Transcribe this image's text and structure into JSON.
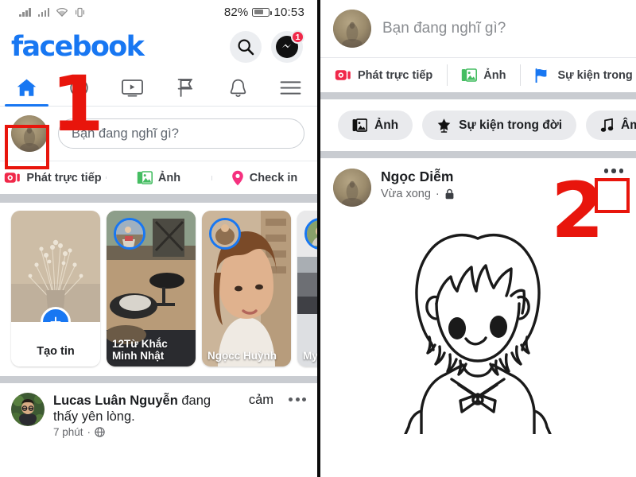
{
  "left_panel": {
    "status_bar": {
      "battery_percent": "82%",
      "time": "10:53",
      "icons": [
        "signal-icon",
        "signal-icon",
        "wifi-icon",
        "vibrate-icon",
        "battery-icon"
      ]
    },
    "header": {
      "wordmark": "facebook",
      "search_icon": "search-icon",
      "messenger_icon": "messenger-icon",
      "messenger_badge": "1"
    },
    "tabs": [
      {
        "name": "home",
        "icon": "home-icon",
        "active": true
      },
      {
        "name": "friends",
        "icon": "friends-icon",
        "active": false
      },
      {
        "name": "watch",
        "icon": "video-icon",
        "active": false
      },
      {
        "name": "marketplace",
        "icon": "flag-icon",
        "active": false
      },
      {
        "name": "notifications",
        "icon": "bell-icon",
        "active": false
      },
      {
        "name": "menu",
        "icon": "hamburger-icon",
        "active": false
      }
    ],
    "composer": {
      "placeholder": "Bạn đang nghĩ gì?",
      "avatar": "user-avatar"
    },
    "actions": [
      {
        "label": "Phát trực tiếp",
        "icon": "live-video-icon",
        "color": "#f02849"
      },
      {
        "label": "Ảnh",
        "icon": "photo-icon",
        "color": "#45bd62"
      },
      {
        "label": "Check in",
        "icon": "location-pin-icon",
        "color": "#f5317f"
      }
    ],
    "stories": [
      {
        "label": "Tạo tin",
        "type": "create",
        "icon": "plus-icon"
      },
      {
        "label": "12Từ Khắc Minh Nhật",
        "type": "story"
      },
      {
        "label": "Ngọcc Huỳnh",
        "type": "story"
      },
      {
        "label": "My",
        "type": "story"
      }
    ],
    "feed_post": {
      "author": "Lucas Luân Nguyễn",
      "action_word": "đang",
      "feeling_word": "cảm",
      "feeling_line2": "thấy yên lòng.",
      "time": "7 phút",
      "privacy_icon": "globe-icon",
      "more_icon": "more-options-icon"
    }
  },
  "right_panel": {
    "composer": {
      "placeholder": "Bạn đang nghĩ gì?",
      "avatar": "user-avatar"
    },
    "actions": [
      {
        "label": "Phát trực tiếp",
        "icon": "live-video-icon",
        "color": "#f02849"
      },
      {
        "label": "Ảnh",
        "icon": "photo-icon",
        "color": "#45bd62"
      },
      {
        "label": "Sự kiện trong đời",
        "icon": "flag-icon",
        "color": "#1877f2"
      }
    ],
    "chips": [
      {
        "label": "Ảnh",
        "icon": "photo-icon"
      },
      {
        "label": "Sự kiện trong đời",
        "icon": "star-icon"
      },
      {
        "label": "Âm nhạc",
        "icon": "music-note-icon"
      }
    ],
    "post": {
      "author": "Ngọc Diễm",
      "time": "Vừa xong",
      "privacy_icon": "lock-icon",
      "more_icon": "more-options-icon",
      "content_image": "line-art-girl-drawing"
    }
  },
  "annotations": [
    {
      "number": "1",
      "target": "profile-avatar"
    },
    {
      "number": "2",
      "target": "post-more-options-button"
    }
  ],
  "colors": {
    "facebook_blue": "#1877f2",
    "annotation_red": "#e8150c",
    "badge_red": "#f02849",
    "gray_separator": "#c9ccd1"
  }
}
